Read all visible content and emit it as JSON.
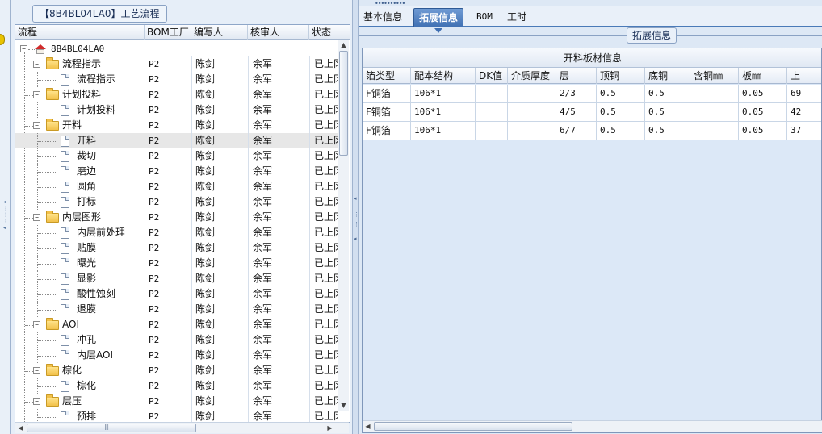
{
  "left_panel": {
    "title": "【8B4BL04LA0】工艺流程",
    "columns": [
      "流程",
      "BOM工厂",
      "编写人",
      "核审人",
      "状态"
    ],
    "root": {
      "label": "8B4BL04LA0"
    },
    "rows": [
      {
        "label": "流程指示",
        "level": 1,
        "type": "folder",
        "bom": "P2",
        "writer": "陈剑",
        "reviewer": "余军",
        "status": "已上冈"
      },
      {
        "label": "流程指示",
        "level": 2,
        "type": "doc",
        "bom": "P2",
        "writer": "陈剑",
        "reviewer": "余军",
        "status": "已上冈"
      },
      {
        "label": "计划投料",
        "level": 1,
        "type": "folder",
        "bom": "P2",
        "writer": "陈剑",
        "reviewer": "余军",
        "status": "已上冈"
      },
      {
        "label": "计划投料",
        "level": 2,
        "type": "doc",
        "bom": "P2",
        "writer": "陈剑",
        "reviewer": "余军",
        "status": "已上冈"
      },
      {
        "label": "开料",
        "level": 1,
        "type": "folder",
        "bom": "P2",
        "writer": "陈剑",
        "reviewer": "余军",
        "status": "已上冈"
      },
      {
        "label": "开料",
        "level": 2,
        "type": "doc",
        "bom": "P2",
        "writer": "陈剑",
        "reviewer": "余军",
        "status": "已上冈",
        "selected": true
      },
      {
        "label": "裁切",
        "level": 2,
        "type": "doc",
        "bom": "P2",
        "writer": "陈剑",
        "reviewer": "余军",
        "status": "已上冈"
      },
      {
        "label": "磨边",
        "level": 2,
        "type": "doc",
        "bom": "P2",
        "writer": "陈剑",
        "reviewer": "余军",
        "status": "已上冈"
      },
      {
        "label": "圆角",
        "level": 2,
        "type": "doc",
        "bom": "P2",
        "writer": "陈剑",
        "reviewer": "余军",
        "status": "已上冈"
      },
      {
        "label": "打标",
        "level": 2,
        "type": "doc",
        "bom": "P2",
        "writer": "陈剑",
        "reviewer": "余军",
        "status": "已上冈"
      },
      {
        "label": "内层图形",
        "level": 1,
        "type": "folder",
        "bom": "P2",
        "writer": "陈剑",
        "reviewer": "余军",
        "status": "已上冈"
      },
      {
        "label": "内层前处理",
        "level": 2,
        "type": "doc",
        "bom": "P2",
        "writer": "陈剑",
        "reviewer": "余军",
        "status": "已上冈"
      },
      {
        "label": "贴膜",
        "level": 2,
        "type": "doc",
        "bom": "P2",
        "writer": "陈剑",
        "reviewer": "余军",
        "status": "已上冈"
      },
      {
        "label": "曝光",
        "level": 2,
        "type": "doc",
        "bom": "P2",
        "writer": "陈剑",
        "reviewer": "余军",
        "status": "已上冈"
      },
      {
        "label": "显影",
        "level": 2,
        "type": "doc",
        "bom": "P2",
        "writer": "陈剑",
        "reviewer": "余军",
        "status": "已上冈"
      },
      {
        "label": "酸性蚀刻",
        "level": 2,
        "type": "doc",
        "bom": "P2",
        "writer": "陈剑",
        "reviewer": "余军",
        "status": "已上冈"
      },
      {
        "label": "退膜",
        "level": 2,
        "type": "doc",
        "bom": "P2",
        "writer": "陈剑",
        "reviewer": "余军",
        "status": "已上冈"
      },
      {
        "label": "AOI",
        "level": 1,
        "type": "folder",
        "bom": "P2",
        "writer": "陈剑",
        "reviewer": "余军",
        "status": "已上冈"
      },
      {
        "label": "冲孔",
        "level": 2,
        "type": "doc",
        "bom": "P2",
        "writer": "陈剑",
        "reviewer": "余军",
        "status": "已上冈"
      },
      {
        "label": "内层AOI",
        "level": 2,
        "type": "doc",
        "bom": "P2",
        "writer": "陈剑",
        "reviewer": "余军",
        "status": "已上冈"
      },
      {
        "label": "棕化",
        "level": 1,
        "type": "folder",
        "bom": "P2",
        "writer": "陈剑",
        "reviewer": "余军",
        "status": "已上冈"
      },
      {
        "label": "棕化",
        "level": 2,
        "type": "doc",
        "bom": "P2",
        "writer": "陈剑",
        "reviewer": "余军",
        "status": "已上冈"
      },
      {
        "label": "层压",
        "level": 1,
        "type": "folder",
        "bom": "P2",
        "writer": "陈剑",
        "reviewer": "余军",
        "status": "已上冈"
      },
      {
        "label": "预排",
        "level": 2,
        "type": "doc",
        "bom": "P2",
        "writer": "陈剑",
        "reviewer": "余军",
        "status": "已上冈"
      }
    ]
  },
  "tabs": [
    {
      "label": "基本信息",
      "active": false
    },
    {
      "label": "拓展信息",
      "active": true
    },
    {
      "label": "BOM",
      "active": false
    },
    {
      "label": "工时",
      "active": false
    }
  ],
  "extended": {
    "group_title": "拓展信息",
    "grid_caption": "开料板材信息",
    "columns": [
      "箔类型",
      "配本结构",
      "DK值",
      "介质厚度",
      "层",
      "顶铜",
      "底铜",
      "含铜㎜",
      "板㎜",
      "上"
    ],
    "rows": [
      [
        "F铜箔",
        "106*1",
        "",
        "",
        "2/3",
        "0.5",
        "0.5",
        "",
        "0.05",
        "69"
      ],
      [
        "F铜箔",
        "106*1",
        "",
        "",
        "4/5",
        "0.5",
        "0.5",
        "",
        "0.05",
        "42"
      ],
      [
        "F铜箔",
        "106*1",
        "",
        "",
        "6/7",
        "0.5",
        "0.5",
        "",
        "0.05",
        "37"
      ]
    ]
  },
  "colors": {
    "accent": "#3f6fb2",
    "panel_bg": "#dde8f5",
    "grid_empty_bg": "#dce8f7"
  }
}
